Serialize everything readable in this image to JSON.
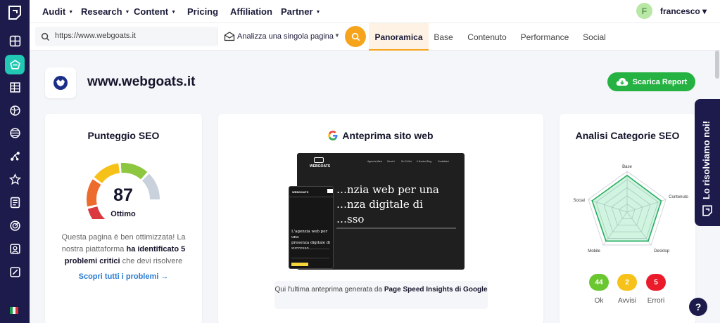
{
  "topnav": {
    "items": [
      {
        "label": "Audit",
        "caret": "▼"
      },
      {
        "label": "Research",
        "caret": "▼"
      },
      {
        "label": "Content",
        "caret": "▼"
      },
      {
        "label": "Pricing",
        "caret": ""
      },
      {
        "label": "Affiliation",
        "caret": ""
      },
      {
        "label": "Partner",
        "caret": "▼"
      }
    ],
    "user": {
      "initial": "F",
      "name": "francesco ▾"
    }
  },
  "search": {
    "url_value": "https://www.webgoats.it",
    "mode_label": "Analizza una singola pagina",
    "mode_caret": "▼",
    "tabs": [
      "Panoramica",
      "Base",
      "Contenuto",
      "Performance",
      "Social"
    ],
    "active_tab": "Panoramica"
  },
  "site": {
    "title": "www.webgoats.it",
    "report_button": "Scarica Report"
  },
  "seo_score": {
    "title": "Punteggio SEO",
    "score": "87",
    "score_fraction": 0.87,
    "label": "Ottimo",
    "desc_1": "Questa pagina è ben ottimizzata! La nostra piattaforma ",
    "desc_bold": "ha identificato 5 problemi critici",
    "desc_2": " che devi risolvere",
    "link": "Scopri tutti i problemi →",
    "colors": [
      "#d9393f",
      "#ec6b2d",
      "#f6c21a",
      "#8dc63f",
      "#c9d1dc"
    ]
  },
  "preview": {
    "title": "Anteprima sito web",
    "desktop_brand": "WEBGOATS",
    "desktop_nav": [
      "Agenzia Web",
      "Servizi",
      "Su Di Noi",
      "Il Nostro Blog",
      "Contattaci"
    ],
    "desktop_headline": [
      "…nzia web per una",
      "…nza digitale di",
      "…sso"
    ],
    "mobile_brand": "WEBGOATS",
    "mobile_headline": [
      "L'agenzia web per una",
      "presenza digitale di",
      "successo"
    ],
    "caption_1": "Qui l'ultima anteprima generata da ",
    "caption_bold": "Page Speed Insights di Google"
  },
  "categories": {
    "title": "Analisi Categorie SEO",
    "axes": [
      "Base",
      "Contenuto",
      "Desktop",
      "Mobile",
      "Social"
    ],
    "values": [
      0.9,
      0.88,
      0.88,
      0.88,
      0.9
    ],
    "stats": [
      {
        "value": "44",
        "label": "Ok",
        "color": "#6ac72f"
      },
      {
        "value": "2",
        "label": "Avvisi",
        "color": "#f6c21a"
      },
      {
        "value": "5",
        "label": "Errori",
        "color": "#ea1c2c"
      }
    ]
  },
  "banner": {
    "text": "Lo risolviamo noi!"
  },
  "help": {
    "label": "?"
  }
}
